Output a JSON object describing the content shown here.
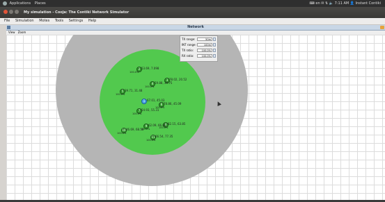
{
  "system_bar": {
    "menu_apps": "Applications",
    "menu_places": "Places",
    "lang": "en",
    "time": "7:11 AM",
    "user": "Instant Contiki"
  },
  "window": {
    "title": "My simulation - Cooja: The Contiki Network Simulator",
    "menus": [
      "File",
      "Simulation",
      "Motes",
      "Tools",
      "Settings",
      "Help"
    ]
  },
  "network_frame": {
    "title": "Network",
    "menus": [
      "View",
      "Zoom"
    ]
  },
  "radio_panel": {
    "tx_range_label": "TX range:",
    "tx_range_value": "50m",
    "int_range_label": "INT range:",
    "int_range_value": "100m",
    "tx_ratio_label": "TX ratio:",
    "tx_ratio_value": "100.0%",
    "rx_ratio_label": "RX ratio:",
    "rx_ratio_value": "100.0%"
  },
  "motes": [
    {
      "id": "2",
      "label": "53.69, 7.098",
      "ratio": "100.0%"
    },
    {
      "id": "3",
      "label": "78.02, 20.52",
      "ratio": "100.0%"
    },
    {
      "id": "4",
      "label": "59.88, 39.75",
      "ratio": "100.0%"
    },
    {
      "id": "5",
      "label": "39.71, 31.48",
      "ratio": "100.0%"
    },
    {
      "id": "1",
      "label": "67.01, 45.03",
      "ratio": ""
    },
    {
      "id": "6",
      "label": "78.86, 45.09",
      "ratio": "100.0%"
    },
    {
      "id": "7",
      "label": "54.93, 55.31",
      "ratio": "100.0%"
    },
    {
      "id": "8",
      "label": "82.15, 63.85",
      "ratio": "100.0%"
    },
    {
      "id": "9",
      "label": "62.09, 66.66",
      "ratio": "100.0%"
    },
    {
      "id": "10",
      "label": "46.69, 68.58",
      "ratio": "100.0%"
    },
    {
      "id": "11",
      "label": "66.54, 77.35",
      "ratio": "100.0%"
    }
  ]
}
